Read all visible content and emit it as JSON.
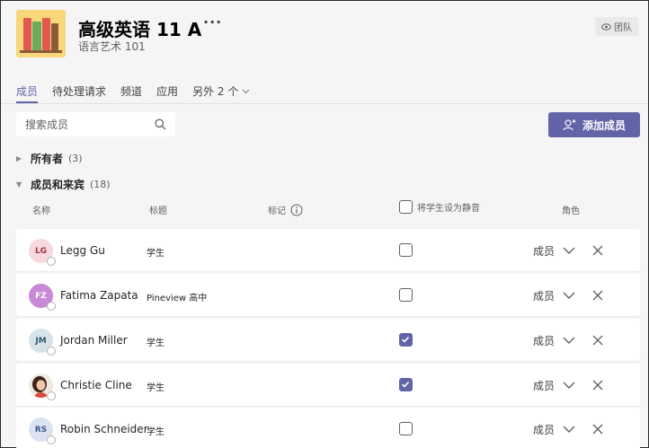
{
  "team": {
    "name": "高级英语 11 A",
    "subtitle": "语言艺术 101",
    "badge": "团队",
    "more": "···"
  },
  "tabs": [
    {
      "label": "成员",
      "active": true
    },
    {
      "label": "待处理请求"
    },
    {
      "label": "频道"
    },
    {
      "label": "应用"
    },
    {
      "label": "另外 2 个"
    }
  ],
  "search": {
    "placeholder": "搜索成员"
  },
  "add_button": {
    "label": "添加成员"
  },
  "groups": {
    "owners": {
      "label": "所有者",
      "count": "(3)"
    },
    "members": {
      "label": "成员和来宾",
      "count": "(18)"
    }
  },
  "columns": {
    "name": "名称",
    "title": "标题",
    "tags": "标记",
    "mute": "将学生设为静音",
    "role": "角色"
  },
  "members": [
    {
      "initials": "LG",
      "name": "Legg Gu",
      "title": "学生",
      "muted": false,
      "role": "成员",
      "avatar_bg": "#f6d8de",
      "avatar_fg": "#a4373a"
    },
    {
      "initials": "FZ",
      "name": "Fatima Zapata",
      "title": "Pineview 高中",
      "muted": false,
      "role": "成员",
      "avatar_bg": "#c88ad6",
      "avatar_fg": "#ffffff"
    },
    {
      "initials": "JM",
      "name": "Jordan Miller",
      "title": "学生",
      "muted": true,
      "role": "成员",
      "avatar_bg": "#d6e4ea",
      "avatar_fg": "#33576e"
    },
    {
      "initials": "",
      "name": "Christie Cline",
      "title": "学生",
      "muted": true,
      "role": "成员",
      "avatar_bg": "#5a3a2e",
      "avatar_fg": "#ffffff"
    },
    {
      "initials": "RS",
      "name": "Robin Schneider",
      "title": "学生",
      "muted": false,
      "role": "成员",
      "avatar_bg": "#dbe3f0",
      "avatar_fg": "#3b5a8a"
    }
  ],
  "colors": {
    "accent": "#6264a7"
  }
}
